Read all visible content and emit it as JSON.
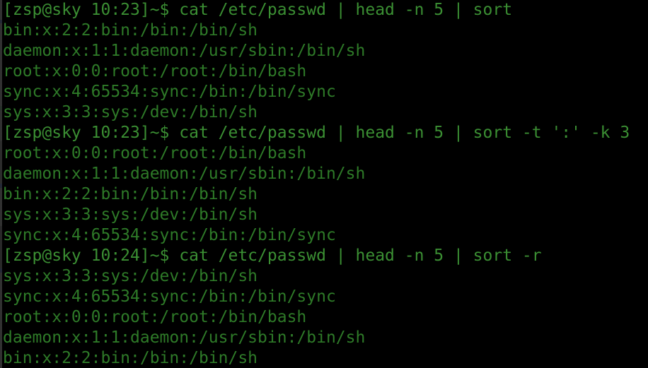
{
  "terminal": {
    "title": "Terminal",
    "background_color": "#000000",
    "prompt_color": "#3b8f33",
    "output_color": "#2e7a28",
    "user": "zsp",
    "host": "sky",
    "cwd": "~",
    "prompt_symbol": "$"
  },
  "lines": [
    {
      "type": "prompt",
      "text": "[zsp@sky 10:23]~$ cat /etc/passwd | head -n 5 | sort"
    },
    {
      "type": "out",
      "text": "bin:x:2:2:bin:/bin:/bin/sh"
    },
    {
      "type": "out",
      "text": "daemon:x:1:1:daemon:/usr/sbin:/bin/sh"
    },
    {
      "type": "out",
      "text": "root:x:0:0:root:/root:/bin/bash"
    },
    {
      "type": "out",
      "text": "sync:x:4:65534:sync:/bin:/bin/sync"
    },
    {
      "type": "out",
      "text": "sys:x:3:3:sys:/dev:/bin/sh"
    },
    {
      "type": "prompt",
      "text": "[zsp@sky 10:23]~$ cat /etc/passwd | head -n 5 | sort -t ':' -k 3"
    },
    {
      "type": "out",
      "text": "root:x:0:0:root:/root:/bin/bash"
    },
    {
      "type": "out",
      "text": "daemon:x:1:1:daemon:/usr/sbin:/bin/sh"
    },
    {
      "type": "out",
      "text": "bin:x:2:2:bin:/bin:/bin/sh"
    },
    {
      "type": "out",
      "text": "sys:x:3:3:sys:/dev:/bin/sh"
    },
    {
      "type": "out",
      "text": "sync:x:4:65534:sync:/bin:/bin/sync"
    },
    {
      "type": "prompt",
      "text": "[zsp@sky 10:24]~$ cat /etc/passwd | head -n 5 | sort -r"
    },
    {
      "type": "out",
      "text": "sys:x:3:3:sys:/dev:/bin/sh"
    },
    {
      "type": "out",
      "text": "sync:x:4:65534:sync:/bin:/bin/sync"
    },
    {
      "type": "out",
      "text": "root:x:0:0:root:/root:/bin/bash"
    },
    {
      "type": "out",
      "text": "daemon:x:1:1:daemon:/usr/sbin:/bin/sh"
    },
    {
      "type": "out",
      "text": "bin:x:2:2:bin:/bin:/bin/sh"
    }
  ],
  "commands": [
    {
      "prompt": "[zsp@sky 10:23]~$",
      "time": "10:23",
      "command": "cat /etc/passwd | head -n 5 | sort"
    },
    {
      "prompt": "[zsp@sky 10:23]~$",
      "time": "10:23",
      "command": "cat /etc/passwd | head -n 5 | sort -t ':' -k 3"
    },
    {
      "prompt": "[zsp@sky 10:24]~$",
      "time": "10:24",
      "command": "cat /etc/passwd | head -n 5 | sort -r"
    }
  ]
}
